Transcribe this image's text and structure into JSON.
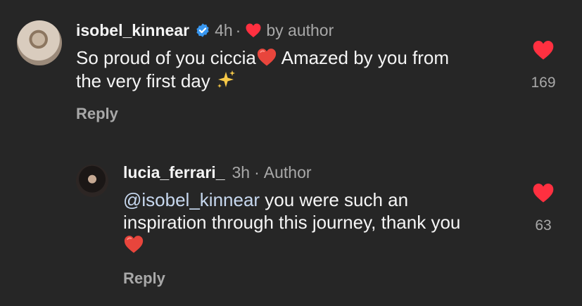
{
  "comments": [
    {
      "username": "isobel_kinnear",
      "verified": true,
      "time": "4h",
      "separator": "·",
      "liked_by": "by author",
      "text_line1": "So proud of you ciccia",
      "text_line1b": " Amazed by you from",
      "text_line2": "the very first day ",
      "like_count": "169",
      "reply_label": "Reply"
    },
    {
      "username": "lucia_ferrari_",
      "time": "3h",
      "separator": "·",
      "role": "Author",
      "mention": "@isobel_kinnear",
      "text_line1": " you were such an",
      "text_line2": "inspiration through this journey, thank you",
      "like_count": "63",
      "reply_label": "Reply"
    }
  ],
  "colors": {
    "background": "#262626",
    "heart": "#ff3040",
    "verified": "#3897f0",
    "mention": "#c7d8ef"
  },
  "icons": [
    "verified-badge-icon",
    "heart-icon",
    "red-heart-emoji",
    "sparkles-emoji"
  ]
}
